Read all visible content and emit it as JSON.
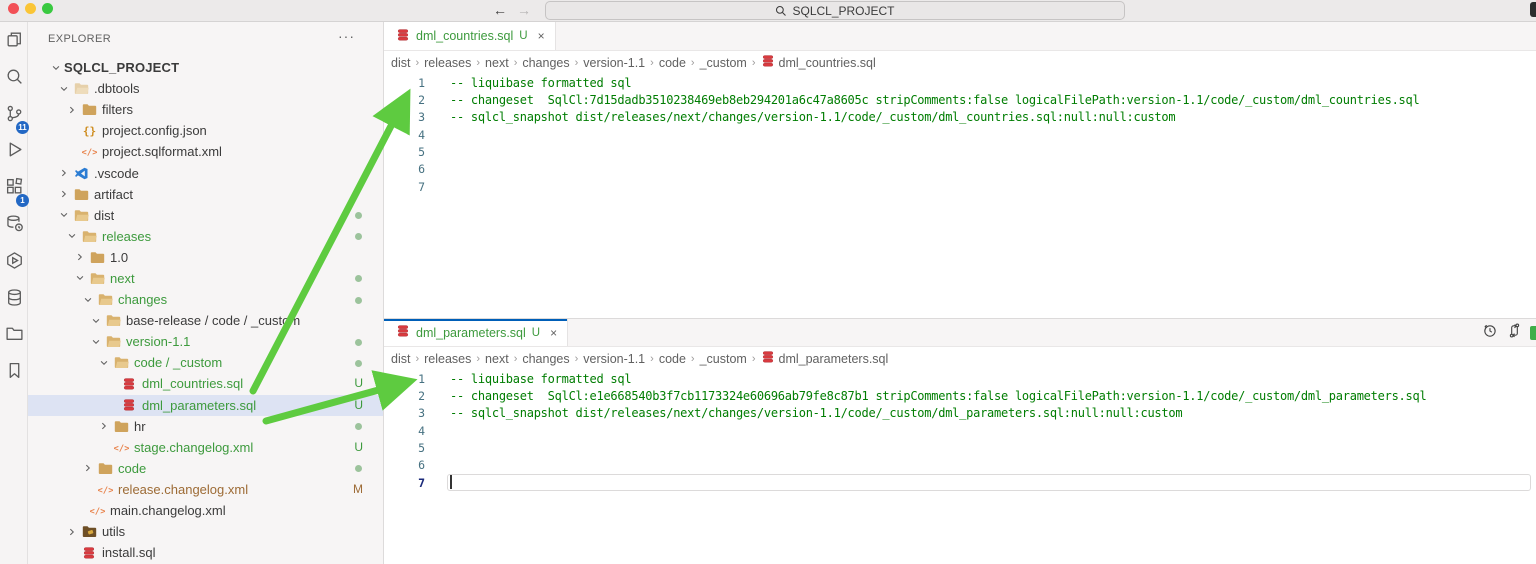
{
  "window": {
    "command_center": "SQLCL_PROJECT",
    "nav_back": "←",
    "nav_forward": "→"
  },
  "activity_bar": {
    "items": [
      {
        "icon": "files-icon",
        "badge": null
      },
      {
        "icon": "search-icon",
        "badge": null
      },
      {
        "icon": "source-control-icon",
        "badge": "11"
      },
      {
        "icon": "run-debug-icon",
        "badge": null
      },
      {
        "icon": "extensions-blocks-icon",
        "badge": "1"
      },
      {
        "icon": "database-history-icon",
        "badge": null
      },
      {
        "icon": "box-play-icon",
        "badge": null
      },
      {
        "icon": "database-icon",
        "badge": null
      },
      {
        "icon": "folder-icon",
        "badge": null
      },
      {
        "icon": "bookmark-icon",
        "badge": null
      }
    ]
  },
  "sidebar": {
    "header": "EXPLORER",
    "more_label": "···",
    "tree": [
      {
        "depth": 0,
        "chevron": "down",
        "icon": null,
        "label": "SQLCL_PROJECT",
        "bold": true
      },
      {
        "depth": 1,
        "chevron": "down",
        "icon": "folder-open-dim",
        "label": ".dbtools"
      },
      {
        "depth": 2,
        "chevron": "right",
        "icon": "folder",
        "label": "filters"
      },
      {
        "depth": 2,
        "chevron": null,
        "icon": "json",
        "label": "project.config.json"
      },
      {
        "depth": 2,
        "chevron": null,
        "icon": "xml",
        "label": "project.sqlformat.xml"
      },
      {
        "depth": 1,
        "chevron": "right",
        "icon": "vscode",
        "label": ".vscode"
      },
      {
        "depth": 1,
        "chevron": "right",
        "icon": "folder",
        "label": "artifact"
      },
      {
        "depth": 1,
        "chevron": "down",
        "icon": "folder-open",
        "label": "dist",
        "badge": "dot"
      },
      {
        "depth": 2,
        "chevron": "down",
        "icon": "folder-open",
        "label": "releases",
        "color": "green",
        "badge": "dot"
      },
      {
        "depth": 3,
        "chevron": "right",
        "icon": "folder",
        "label": "1.0"
      },
      {
        "depth": 3,
        "chevron": "down",
        "icon": "folder-open",
        "label": "next",
        "color": "green",
        "badge": "dot"
      },
      {
        "depth": 4,
        "chevron": "down",
        "icon": "folder-open",
        "label": "changes",
        "color": "green",
        "badge": "dot"
      },
      {
        "depth": 5,
        "chevron": "down",
        "icon": "folder-open",
        "label": "base-release / code / _custom"
      },
      {
        "depth": 5,
        "chevron": "down",
        "icon": "folder-open",
        "label": "version-1.1",
        "color": "green",
        "badge": "dot"
      },
      {
        "depth": 6,
        "chevron": "down",
        "icon": "folder-open",
        "label": "code / _custom",
        "color": "green",
        "badge": "dot"
      },
      {
        "depth": 7,
        "chevron": null,
        "icon": "db",
        "label": "dml_countries.sql",
        "color": "green",
        "badge": "U"
      },
      {
        "depth": 7,
        "chevron": null,
        "icon": "db",
        "label": "dml_parameters.sql",
        "color": "green",
        "badge": "U",
        "selected": true
      },
      {
        "depth": 6,
        "chevron": "right",
        "icon": "folder",
        "label": "hr",
        "badge": "dot"
      },
      {
        "depth": 6,
        "chevron": null,
        "icon": "xml",
        "label": "stage.changelog.xml",
        "color": "green",
        "badge": "U"
      },
      {
        "depth": 4,
        "chevron": "right",
        "icon": "folder",
        "label": "code",
        "color": "green",
        "badge": "dot"
      },
      {
        "depth": 4,
        "chevron": null,
        "icon": "xml",
        "label": "release.changelog.xml",
        "color": "orange",
        "badge": "M"
      },
      {
        "depth": 3,
        "chevron": null,
        "icon": "xml",
        "label": "main.changelog.xml"
      },
      {
        "depth": 2,
        "chevron": "right",
        "icon": "folder-utils",
        "label": "utils"
      },
      {
        "depth": 2,
        "chevron": null,
        "icon": "db",
        "label": "install.sql"
      }
    ]
  },
  "editors": [
    {
      "tab": {
        "title": "dml_countries.sql",
        "dirty": "U",
        "close": "×"
      },
      "breadcrumb": [
        "dist",
        "releases",
        "next",
        "changes",
        "version-1.1",
        "code",
        "_custom",
        "dml_countries.sql"
      ],
      "lines": [
        "-- liquibase formatted sql",
        "-- changeset  SqlCl:7d15dadb3510238469eb8eb294201a6c47a8605c stripComments:false logicalFilePath:version-1.1/code/_custom/dml_countries.sql",
        "-- sqlcl_snapshot dist/releases/next/changes/version-1.1/code/_custom/dml_countries.sql:null:null:custom",
        "",
        "",
        "",
        ""
      ],
      "current_line": null,
      "accent_tab": false,
      "actions": []
    },
    {
      "tab": {
        "title": "dml_parameters.sql",
        "dirty": "U",
        "close": "×"
      },
      "breadcrumb": [
        "dist",
        "releases",
        "next",
        "changes",
        "version-1.1",
        "code",
        "_custom",
        "dml_parameters.sql"
      ],
      "lines": [
        "-- liquibase formatted sql",
        "-- changeset  SqlCl:e1e668540b3f7cb1173324e60696ab79fe8c87b1 stripComments:false logicalFilePath:version-1.1/code/_custom/dml_parameters.sql",
        "-- sqlcl_snapshot dist/releases/next/changes/version-1.1/code/_custom/dml_parameters.sql:null:null:custom",
        "",
        "",
        "",
        ""
      ],
      "current_line": 7,
      "accent_tab": true,
      "actions": [
        "timeline-history-icon",
        "compare-changes-icon"
      ]
    }
  ],
  "colors": {
    "accent": "#005fb8",
    "comment-green": "#007d02",
    "tree-green": "#3d9a3d",
    "tree-orange": "#9d6b35",
    "arrow-green": "#5ecb40",
    "badge-blue": "#2368c4",
    "file-db-red": "#d93a3f",
    "folder-tan": "#dcb67a"
  }
}
